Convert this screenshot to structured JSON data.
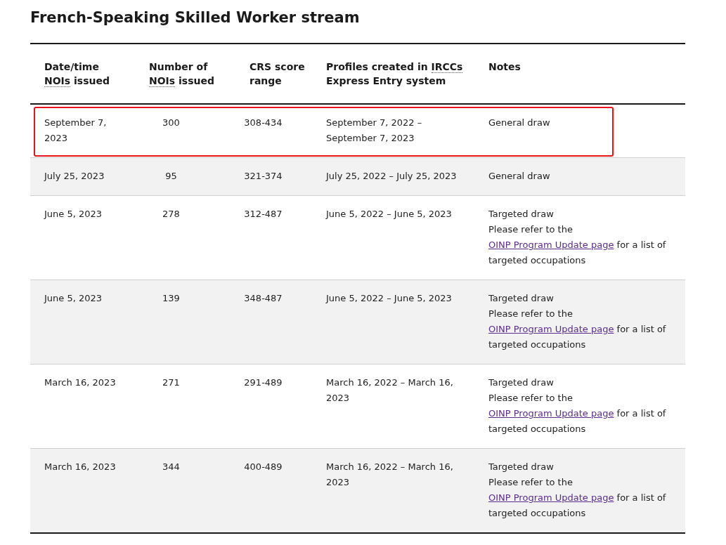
{
  "title": "French-Speaking Skilled Worker stream",
  "table": {
    "columns": [
      {
        "parts": [
          {
            "text": "Date/time "
          },
          {
            "text": "NOIs",
            "abbr": true
          },
          {
            "text": " issued"
          }
        ]
      },
      {
        "parts": [
          {
            "text": "Number of "
          },
          {
            "text": "NOIs",
            "abbr": true
          },
          {
            "text": " issued"
          }
        ]
      },
      {
        "parts": [
          {
            "text": "CRS score range"
          }
        ]
      },
      {
        "parts": [
          {
            "text": "Profiles created in "
          },
          {
            "text": "IRCCs",
            "abbr": true
          },
          {
            "text": " Express Entry system"
          }
        ]
      },
      {
        "parts": [
          {
            "text": "Notes"
          }
        ]
      }
    ],
    "rows": [
      {
        "highlighted": true,
        "date": "September 7, 2023",
        "count": "300",
        "range": "308-434",
        "profiles": "September 7, 2022 – September 7, 2023",
        "notes": {
          "kind": "general",
          "title": "General draw"
        }
      },
      {
        "highlighted": false,
        "date": "July 25, 2023",
        "count": "95",
        "range": "321-374",
        "profiles": "July 25, 2022 – July 25, 2023",
        "notes": {
          "kind": "general",
          "title": "General draw"
        }
      },
      {
        "highlighted": false,
        "date": "June 5, 2023",
        "count": "278",
        "range": "312-487",
        "profiles": "June 5, 2022 – June 5, 2023",
        "notes": {
          "kind": "targeted",
          "title": "Targeted draw",
          "before": "Please refer to the ",
          "link": "OINP Program Update page",
          "after": " for a list of targeted occupations"
        }
      },
      {
        "highlighted": false,
        "date": "June 5, 2023",
        "count": "139",
        "range": "348-487",
        "profiles": "June 5, 2022 – June 5, 2023",
        "notes": {
          "kind": "targeted",
          "title": "Targeted draw",
          "before": "Please refer to the ",
          "link": "OINP Program Update page",
          "after": " for a list of targeted occupations"
        }
      },
      {
        "highlighted": false,
        "date": "March 16, 2023",
        "count": "271",
        "range": "291-489",
        "profiles": "March 16, 2022 – March 16, 2023",
        "notes": {
          "kind": "targeted",
          "title": "Targeted draw",
          "before": "Please refer to the ",
          "link": "OINP Program Update page",
          "after": " for a list of targeted occupations"
        }
      },
      {
        "highlighted": false,
        "date": "March 16, 2023",
        "count": "344",
        "range": "400-489",
        "profiles": "March 16, 2022 – March 16, 2023",
        "notes": {
          "kind": "targeted",
          "title": "Targeted draw",
          "before": "Please refer to the ",
          "link": "OINP Program Update page",
          "after": " for a list of targeted occupations"
        }
      }
    ]
  }
}
